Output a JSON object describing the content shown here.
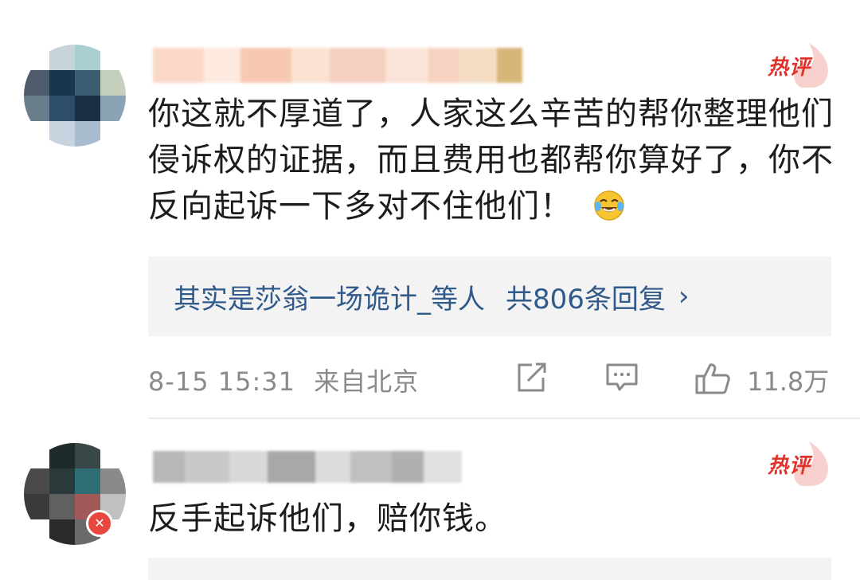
{
  "comments": [
    {
      "hot_label": "热评",
      "text": "你这就不厚道了，人家这么辛苦的帮你整理他们侵诉权的证据，而且费用也都帮你算好了，你不反向起诉一下多对不住他们！",
      "emoji": "laughing-with-tears-emoji",
      "replies": {
        "who": "其实是莎翁一场诡计_等人",
        "count": "共806条回复",
        "chevron": "›"
      },
      "meta": {
        "timestamp": "8-15 15:31",
        "location": "来自北京",
        "likes": "11.8万"
      },
      "icons": {
        "share": "share-icon",
        "comment": "comment-icon",
        "like": "thumbs-up-icon"
      }
    },
    {
      "hot_label": "热评",
      "text": "反手起诉他们，赔你钱。"
    }
  ],
  "colors": {
    "hot_red": "#e0322b",
    "link_blue": "#2f5a8a",
    "meta_gray": "#8a8a8a",
    "reply_bg": "#f3f3f3"
  }
}
